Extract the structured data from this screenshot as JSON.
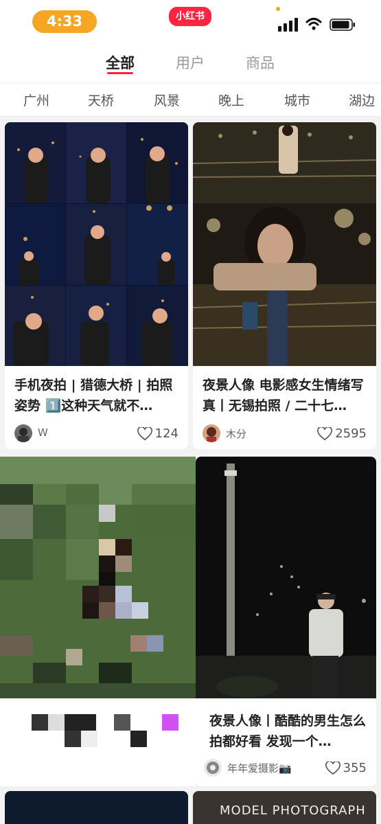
{
  "status_bar": {
    "time": "4:33",
    "app_badge": "小红书",
    "icons": [
      "signal-icon",
      "wifi-icon",
      "battery-icon"
    ]
  },
  "tabs": [
    {
      "label": "全部",
      "active": true
    },
    {
      "label": "用户",
      "active": false
    },
    {
      "label": "商品",
      "active": false
    }
  ],
  "filters": [
    "广州",
    "天桥",
    "风景",
    "晚上",
    "城市",
    "湖边"
  ],
  "cards": [
    {
      "title": "手机夜拍 | 猎德大桥 | 拍照姿势 1️⃣这种天气就不…",
      "author": "W",
      "likes": "124"
    },
    {
      "title": "夜景人像 电影感女生情绪写真丨无锡拍照 / 二十七…",
      "author": "木分",
      "likes": "2595"
    },
    {
      "title": "",
      "author": "",
      "likes": ""
    },
    {
      "title": "夜景人像丨酷酷的男生怎么拍都好看 发现一个…",
      "author": "年年爱摄影📷",
      "likes": "355"
    }
  ],
  "watermark": "MODEL PHOTOGRAPH",
  "colors": {
    "brand": "#ff2442",
    "time_pill": "#f5a623"
  }
}
